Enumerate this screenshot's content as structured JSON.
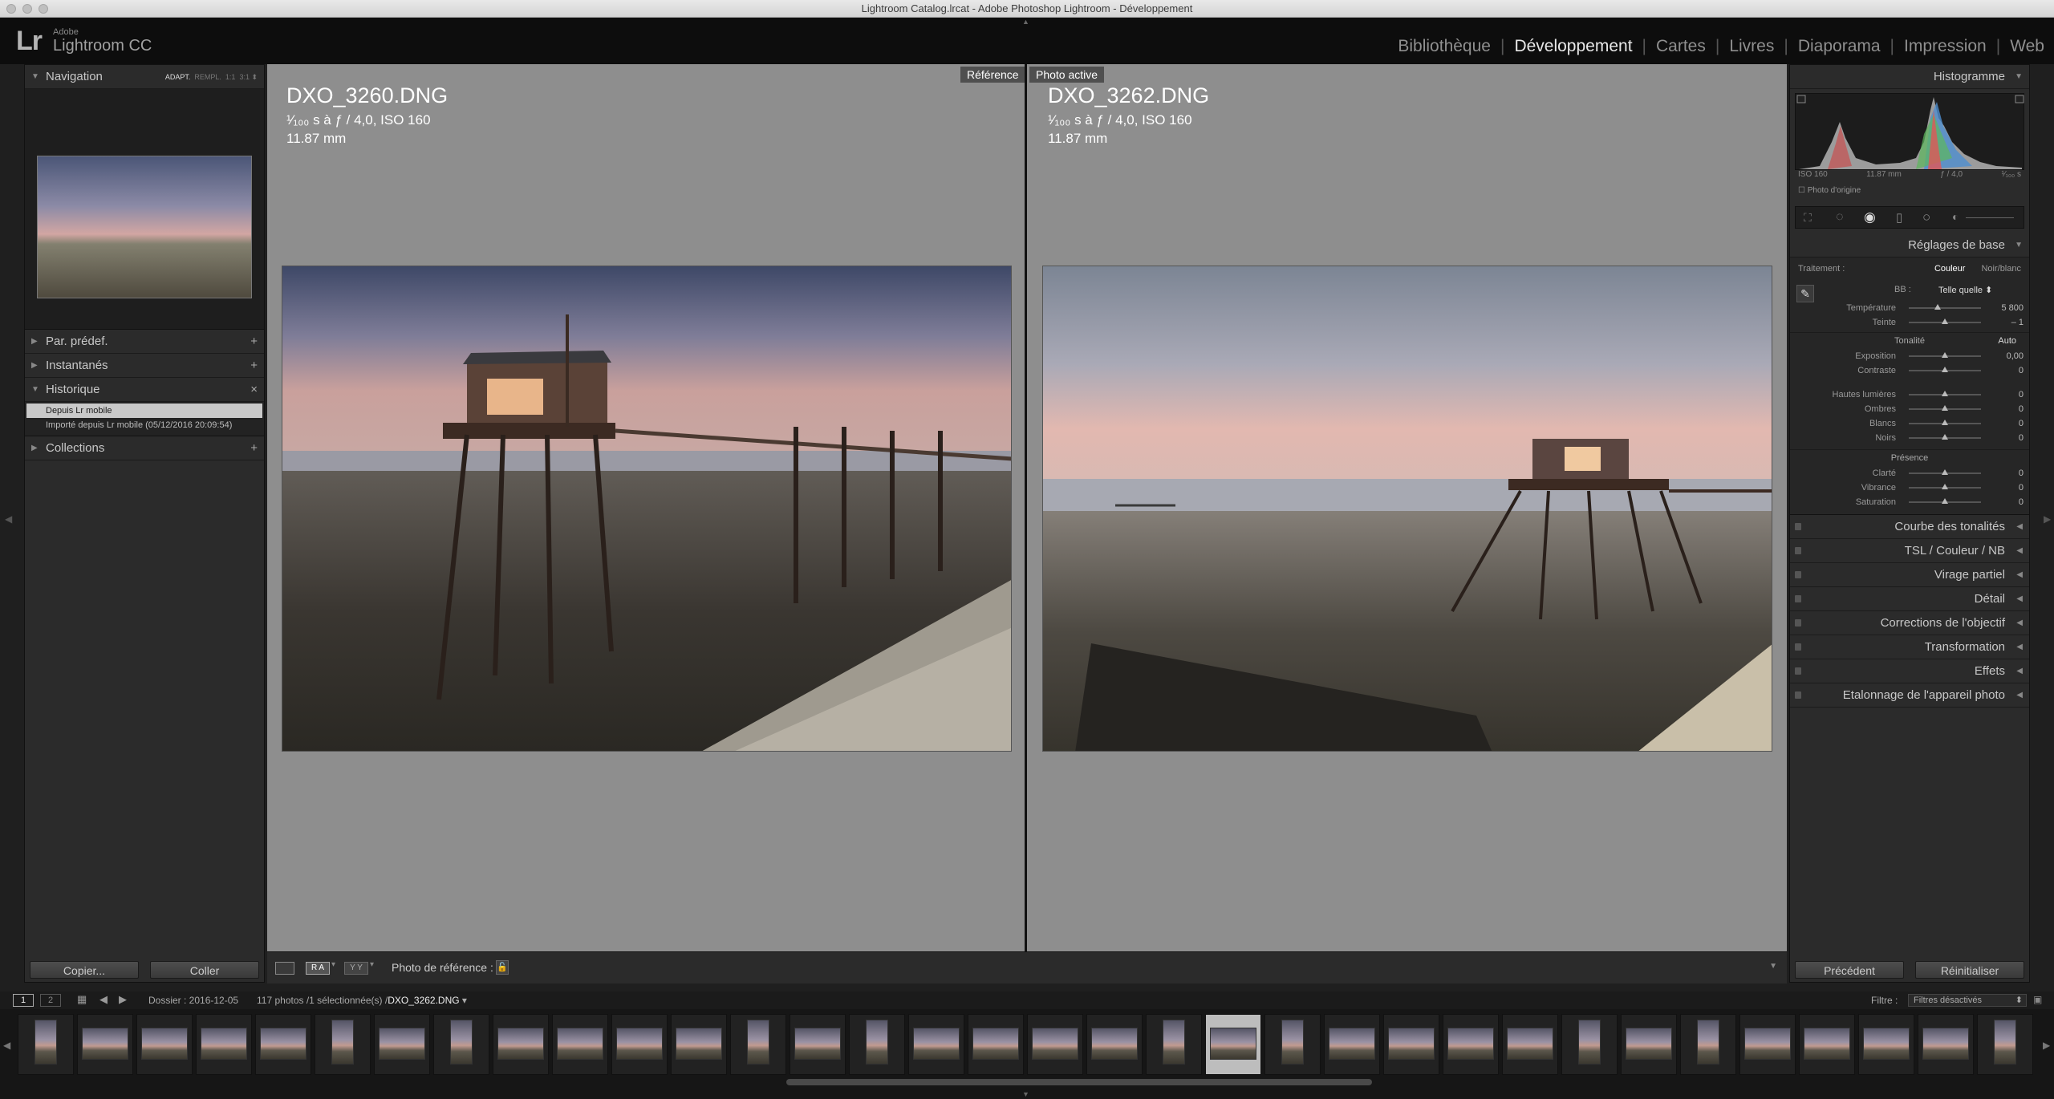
{
  "window": {
    "title": "Lightroom Catalog.lrcat - Adobe Photoshop Lightroom - Développement"
  },
  "identity": {
    "logo": "Lr",
    "adobe": "Adobe",
    "product": "Lightroom CC"
  },
  "modules": [
    "Bibliothèque",
    "Développement",
    "Cartes",
    "Livres",
    "Diaporama",
    "Impression",
    "Web"
  ],
  "active_module": "Développement",
  "left": {
    "navigator": {
      "label": "Navigation",
      "zoom": [
        "ADAPT.",
        "REMPL.",
        "1:1",
        "3:1"
      ]
    },
    "presets": "Par. prédef.",
    "snapshots": "Instantanés",
    "history": {
      "label": "Historique",
      "items": [
        "Depuis Lr mobile",
        "Importé depuis Lr mobile (05/12/2016 20:09:54)"
      ]
    },
    "collections": "Collections",
    "copy_btn": "Copier...",
    "paste_btn": "Coller"
  },
  "compare": {
    "reference_tag": "Référence",
    "active_tag": "Photo active",
    "left": {
      "file": "DXO_3260.DNG",
      "exposure": "¹⁄₁₀₀ s à ƒ / 4,0, ISO 160",
      "focal": "11.87 mm"
    },
    "right": {
      "file": "DXO_3262.DNG",
      "exposure": "¹⁄₁₀₀ s à ƒ / 4,0, ISO 160",
      "focal": "11.87 mm"
    },
    "ref_label": "Photo de référence :"
  },
  "right": {
    "histogram": {
      "label": "Histogramme",
      "iso": "ISO 160",
      "focal": "11.87 mm",
      "aperture": "ƒ / 4,0",
      "shutter": "¹⁄₁₀₀ s",
      "origin": "Photo d'origine"
    },
    "basic": {
      "label": "Réglages de base",
      "treatment": "Traitement :",
      "color": "Couleur",
      "bw": "Noir/blanc",
      "wb_label": "BB :",
      "wb_value": "Telle quelle",
      "sliders_wb": [
        {
          "label": "Température",
          "value": "5 800",
          "pos": 0.4
        },
        {
          "label": "Teinte",
          "value": "– 1",
          "pos": 0.5
        }
      ],
      "tone_label": "Tonalité",
      "auto": "Auto",
      "sliders_tone": [
        {
          "label": "Exposition",
          "value": "0,00",
          "pos": 0.5
        },
        {
          "label": "Contraste",
          "value": "0",
          "pos": 0.5
        }
      ],
      "sliders_light": [
        {
          "label": "Hautes lumières",
          "value": "0",
          "pos": 0.5
        },
        {
          "label": "Ombres",
          "value": "0",
          "pos": 0.5
        },
        {
          "label": "Blancs",
          "value": "0",
          "pos": 0.5
        },
        {
          "label": "Noirs",
          "value": "0",
          "pos": 0.5
        }
      ],
      "presence_label": "Présence",
      "sliders_presence": [
        {
          "label": "Clarté",
          "value": "0",
          "pos": 0.5
        },
        {
          "label": "Vibrance",
          "value": "0",
          "pos": 0.5
        },
        {
          "label": "Saturation",
          "value": "0",
          "pos": 0.5
        }
      ]
    },
    "sections": [
      "Courbe des tonalités",
      "TSL / Couleur / NB",
      "Virage partiel",
      "Détail",
      "Corrections de l'objectif",
      "Transformation",
      "Effets",
      "Etalonnage de l'appareil photo"
    ],
    "prev_btn": "Précédent",
    "reset_btn": "Réinitialiser"
  },
  "filmstrip": {
    "screens": [
      "1",
      "2"
    ],
    "folder": "Dossier : 2016-12-05",
    "count": "117 photos /1 sélectionnée(s) /",
    "current": "DXO_3262.DNG",
    "filter_label": "Filtre :",
    "filter_value": "Filtres désactivés"
  }
}
